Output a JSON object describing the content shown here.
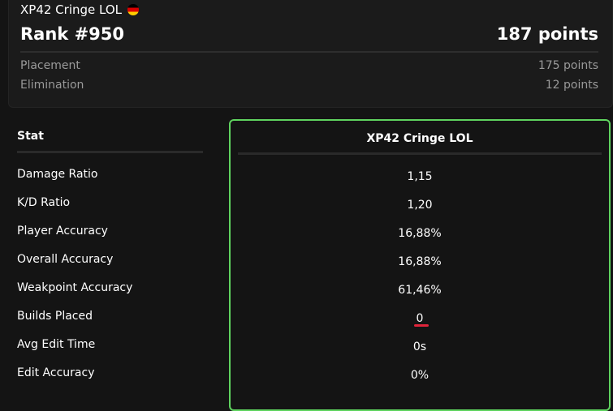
{
  "player": {
    "name": "XP42 Cringe LOL",
    "flag_icon": "germany-flag-icon",
    "rank": "Rank #950",
    "total_points": "187 points"
  },
  "breakdown": [
    {
      "label": "Placement",
      "value": "175 points"
    },
    {
      "label": "Elimination",
      "value": "12 points"
    }
  ],
  "table": {
    "stat_header": "Stat",
    "player_header": "XP42 Cringe LOL",
    "rows": [
      {
        "label": "Damage Ratio",
        "value": "1,15"
      },
      {
        "label": "K/D Ratio",
        "value": "1,20"
      },
      {
        "label": "Player Accuracy",
        "value": "16,88%"
      },
      {
        "label": "Overall Accuracy",
        "value": "16,88%"
      },
      {
        "label": "Weakpoint Accuracy",
        "value": "61,46%"
      },
      {
        "label": "Builds Placed",
        "value": "0"
      },
      {
        "label": "Avg Edit Time",
        "value": "0s"
      },
      {
        "label": "Edit Accuracy",
        "value": "0%"
      }
    ]
  },
  "colors": {
    "highlight_border": "#5fd35f",
    "underline_mark": "#e0243a"
  }
}
